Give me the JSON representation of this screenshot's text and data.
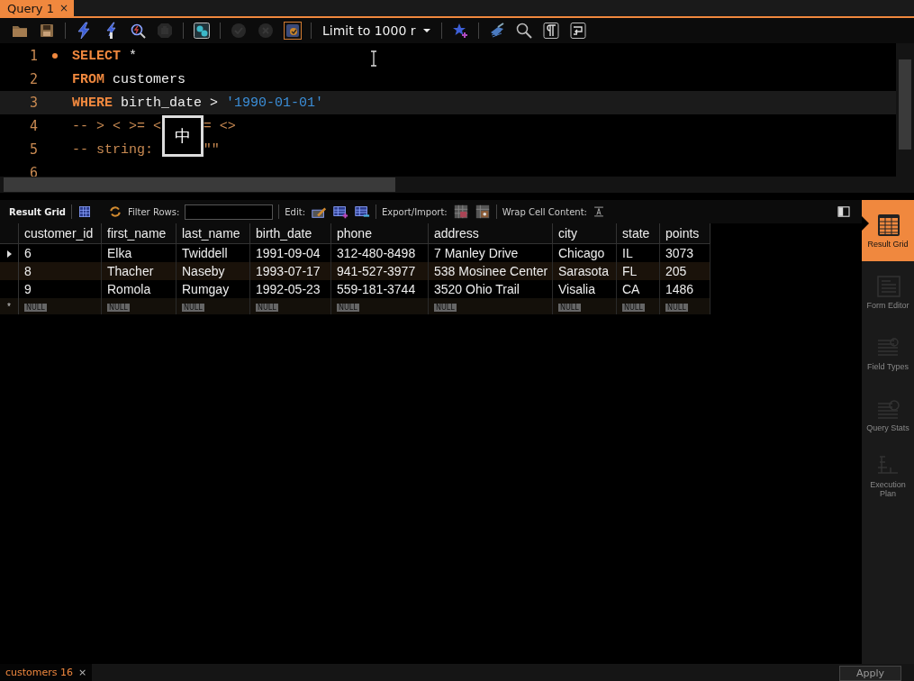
{
  "tabs": [
    {
      "label": "Query 1",
      "close": "×",
      "selected": true
    }
  ],
  "toolbar": [
    {
      "kind": "folder",
      "disabled": false,
      "on": false
    },
    {
      "kind": "save",
      "disabled": false,
      "on": false
    },
    {
      "kind": "sep"
    },
    {
      "kind": "bolt",
      "disabled": false,
      "on": false
    },
    {
      "kind": "bolt-cursor",
      "disabled": false,
      "on": false
    },
    {
      "kind": "explain",
      "disabled": false,
      "on": false
    },
    {
      "kind": "stop",
      "disabled": true,
      "on": false
    },
    {
      "kind": "sep"
    },
    {
      "kind": "toggle-output",
      "disabled": false,
      "on": false
    },
    {
      "kind": "sep"
    },
    {
      "kind": "commit",
      "disabled": true,
      "on": false
    },
    {
      "kind": "rollback",
      "disabled": true,
      "on": false
    },
    {
      "kind": "autocommit",
      "disabled": false,
      "on": true
    },
    {
      "kind": "sep"
    },
    {
      "kind": "limit",
      "text": "Limit to 1000 r"
    },
    {
      "kind": "sep"
    },
    {
      "kind": "star",
      "disabled": false,
      "on": false
    },
    {
      "kind": "sep"
    },
    {
      "kind": "brush",
      "disabled": false,
      "on": false
    },
    {
      "kind": "find",
      "disabled": false,
      "on": false
    },
    {
      "kind": "pilcrow",
      "disabled": false,
      "on": false
    },
    {
      "kind": "wrap",
      "disabled": false,
      "on": false
    }
  ],
  "editor": {
    "lines": [
      {
        "number": "1",
        "marker": true,
        "current": false,
        "tokens": [
          {
            "kind": "keyword",
            "text": "SELECT"
          },
          {
            "kind": "plain",
            "text": " *"
          }
        ]
      },
      {
        "number": "2",
        "marker": false,
        "current": false,
        "tokens": [
          {
            "kind": "keyword",
            "text": "FROM"
          },
          {
            "kind": "plain",
            "text": " customers"
          }
        ]
      },
      {
        "number": "3",
        "marker": false,
        "current": true,
        "tokens": [
          {
            "kind": "keyword",
            "text": "WHERE"
          },
          {
            "kind": "plain",
            "text": " birth_date > "
          },
          {
            "kind": "string",
            "text": "'1990-01-01'"
          }
        ]
      },
      {
        "number": "4",
        "marker": false,
        "current": false,
        "tokens": [
          {
            "kind": "comment",
            "text": "-- > < >= <"
          }
        ],
        "after_popup": [
          {
            "kind": "comment",
            "text": "= <>"
          }
        ]
      },
      {
        "number": "5",
        "marker": false,
        "current": false,
        "tokens": [
          {
            "kind": "comment",
            "text": "-- string:"
          }
        ],
        "after_popup": [
          {
            "kind": "comment",
            "text": "\"\""
          }
        ]
      },
      {
        "number": "6",
        "marker": false,
        "current": false
      }
    ],
    "ime_popup": {
      "text": "中"
    }
  },
  "result_toolbar": {
    "title": "Result Grid",
    "filter_label": "Filter Rows:",
    "edit_label": "Edit:",
    "export_label": "Export/Import:",
    "wrap_label": "Wrap Cell Content:"
  },
  "grid": {
    "columns": [
      "customer_id",
      "first_name",
      "last_name",
      "birth_date",
      "phone",
      "address",
      "city",
      "state",
      "points"
    ],
    "rows": [
      {
        "selected": true,
        "cells": [
          "6",
          "Elka",
          "Twiddell",
          "1991-09-04",
          "312-480-8498",
          "7 Manley Drive",
          "Chicago",
          "IL",
          "3073"
        ]
      },
      {
        "selected": false,
        "cells": [
          "8",
          "Thacher",
          "Naseby",
          "1993-07-17",
          "941-527-3977",
          "538 Mosinee Center",
          "Sarasota",
          "FL",
          "205"
        ]
      },
      {
        "selected": false,
        "cells": [
          "9",
          "Romola",
          "Rumgay",
          "1992-05-23",
          "559-181-3744",
          "3520 Ohio Trail",
          "Visalia",
          "CA",
          "1486"
        ]
      }
    ],
    "new_row": {
      "marker": "*",
      "cells": [
        "NULL",
        "NULL",
        "NULL",
        "NULL",
        "NULL",
        "NULL",
        "NULL",
        "NULL",
        "NULL"
      ]
    }
  },
  "side_panel": [
    {
      "kind": "grid",
      "label": "Result Grid",
      "selected": true
    },
    {
      "kind": "form",
      "label": "Form Editor",
      "selected": false
    },
    {
      "kind": "types",
      "label": "Field Types",
      "selected": false
    },
    {
      "kind": "stats",
      "label": "Query Stats",
      "selected": false
    },
    {
      "kind": "plan",
      "label": "Execution Plan",
      "selected": false
    }
  ],
  "bottom_tabs": [
    {
      "label": "customers 16",
      "close": "×",
      "selected": true
    }
  ],
  "apply_button": "Apply"
}
